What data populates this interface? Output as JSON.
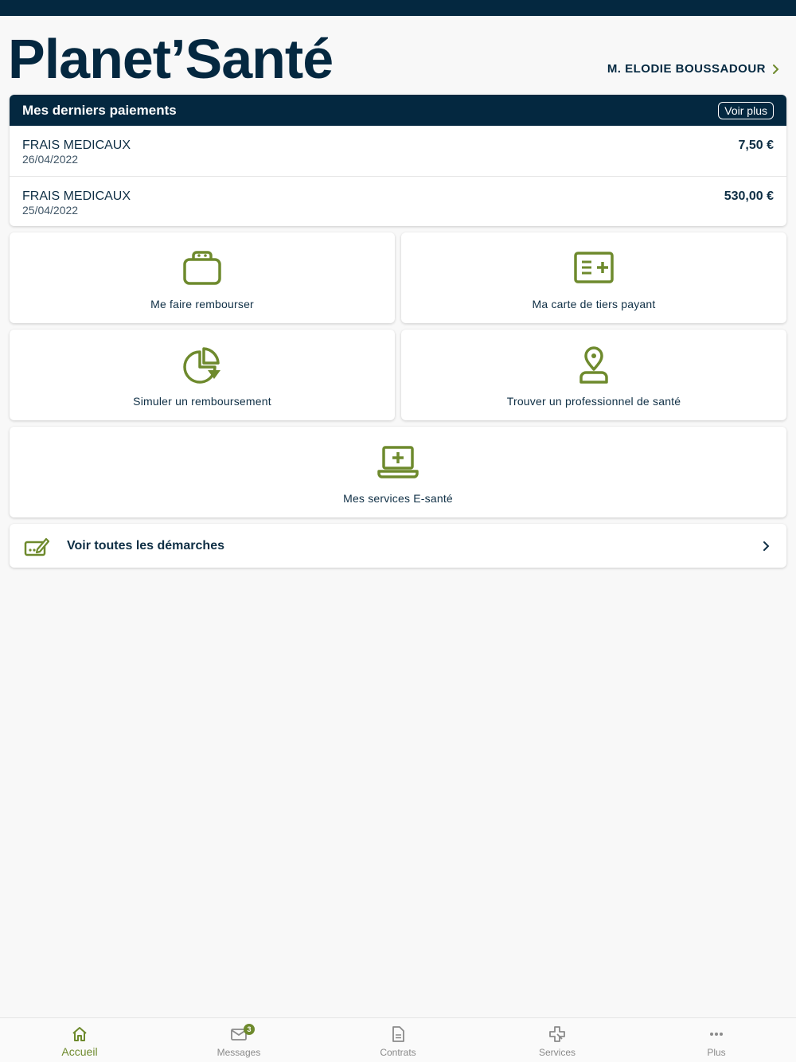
{
  "app": {
    "brand": "Planet’Santé"
  },
  "user": {
    "name": "M. ELODIE BOUSSADOUR"
  },
  "payments": {
    "title": "Mes derniers paiements",
    "more_label": "Voir plus",
    "rows": [
      {
        "label": "FRAIS MEDICAUX",
        "date": "26/04/2022",
        "amount": "7,50 €"
      },
      {
        "label": "FRAIS MEDICAUX",
        "date": "25/04/2022",
        "amount": "530,00 €"
      }
    ]
  },
  "tiles": [
    {
      "label": "Me faire rembourser",
      "icon": "bag-icon"
    },
    {
      "label": "Ma carte de tiers payant",
      "icon": "card-plus-icon"
    },
    {
      "label": "Simuler un remboursement",
      "icon": "pie-chart-icon"
    },
    {
      "label": "Trouver un professionnel de santé",
      "icon": "doctor-pin-icon"
    },
    {
      "label": "Mes services E-santé",
      "icon": "laptop-medical-icon"
    }
  ],
  "demarches": {
    "label": "Voir toutes les démarches",
    "icon": "edit-form-icon"
  },
  "tabbar": {
    "items": [
      {
        "label": "Accueil",
        "icon": "home-icon",
        "active": true
      },
      {
        "label": "Messages",
        "icon": "mail-icon",
        "badge": "3"
      },
      {
        "label": "Contrats",
        "icon": "document-icon"
      },
      {
        "label": "Services",
        "icon": "medical-cross-icon"
      },
      {
        "label": "Plus",
        "icon": "more-icon"
      }
    ]
  },
  "colors": {
    "navy": "#042840",
    "accent": "#6e8a2d",
    "background": "#f8f8f8"
  }
}
